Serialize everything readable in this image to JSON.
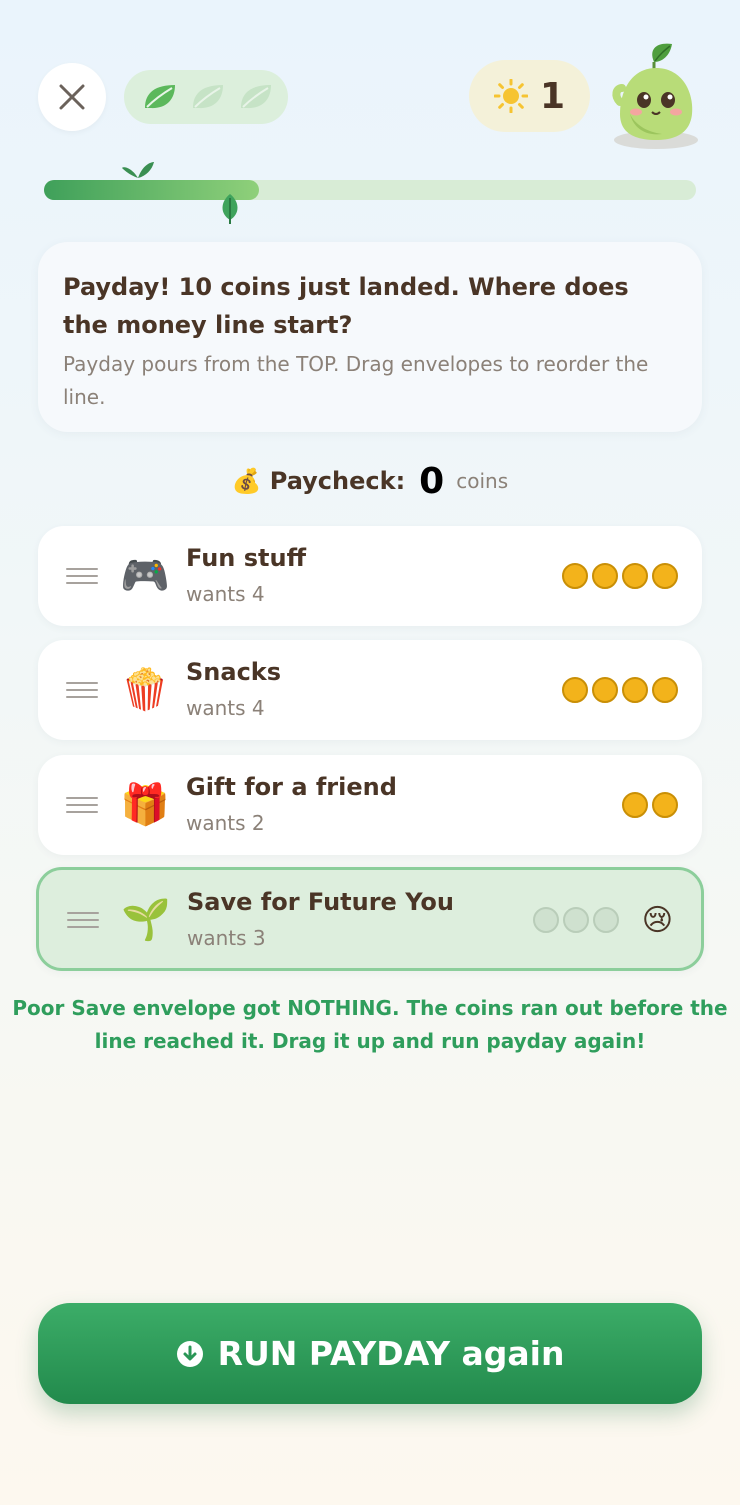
{
  "header": {
    "close_icon": "close-icon",
    "leaves_filled": 1,
    "leaves_total": 3,
    "sun_icon": "sun-icon",
    "sun_count": "1"
  },
  "progress": {
    "fraction": 0.33
  },
  "prompt": {
    "title": "Payday! 10 coins just landed. Where does the money line start?",
    "subtitle": "Payday pours from the TOP. Drag envelopes to reorder the line."
  },
  "paycheck": {
    "icon": "💰",
    "label": "Paycheck:",
    "value": "0",
    "unit": "coins"
  },
  "envelopes": [
    {
      "emoji": "🎮",
      "name": "Fun stuff",
      "wants": "wants 4",
      "coins_filled": 4,
      "coins_total": 4
    },
    {
      "emoji": "🍿",
      "name": "Snacks",
      "wants": "wants 4",
      "coins_filled": 4,
      "coins_total": 4
    },
    {
      "emoji": "🎁",
      "name": "Gift for a friend",
      "wants": "wants 2",
      "coins_filled": 2,
      "coins_total": 2
    },
    {
      "emoji": "🌱",
      "name": "Save for Future You",
      "wants": "wants 3",
      "coins_filled": 0,
      "coins_total": 3,
      "status_emoji": "😢",
      "highlighted": true
    }
  ],
  "message": "Poor Save envelope got NOTHING. The coins ran out before the line reached it. Drag it up and run payday again!",
  "run_button": {
    "label": "RUN PAYDAY again",
    "icon": "download-circle-icon"
  },
  "colors": {
    "accent": "#2f9e5c",
    "coin": "#f3b31b",
    "button": "#2a9656"
  }
}
